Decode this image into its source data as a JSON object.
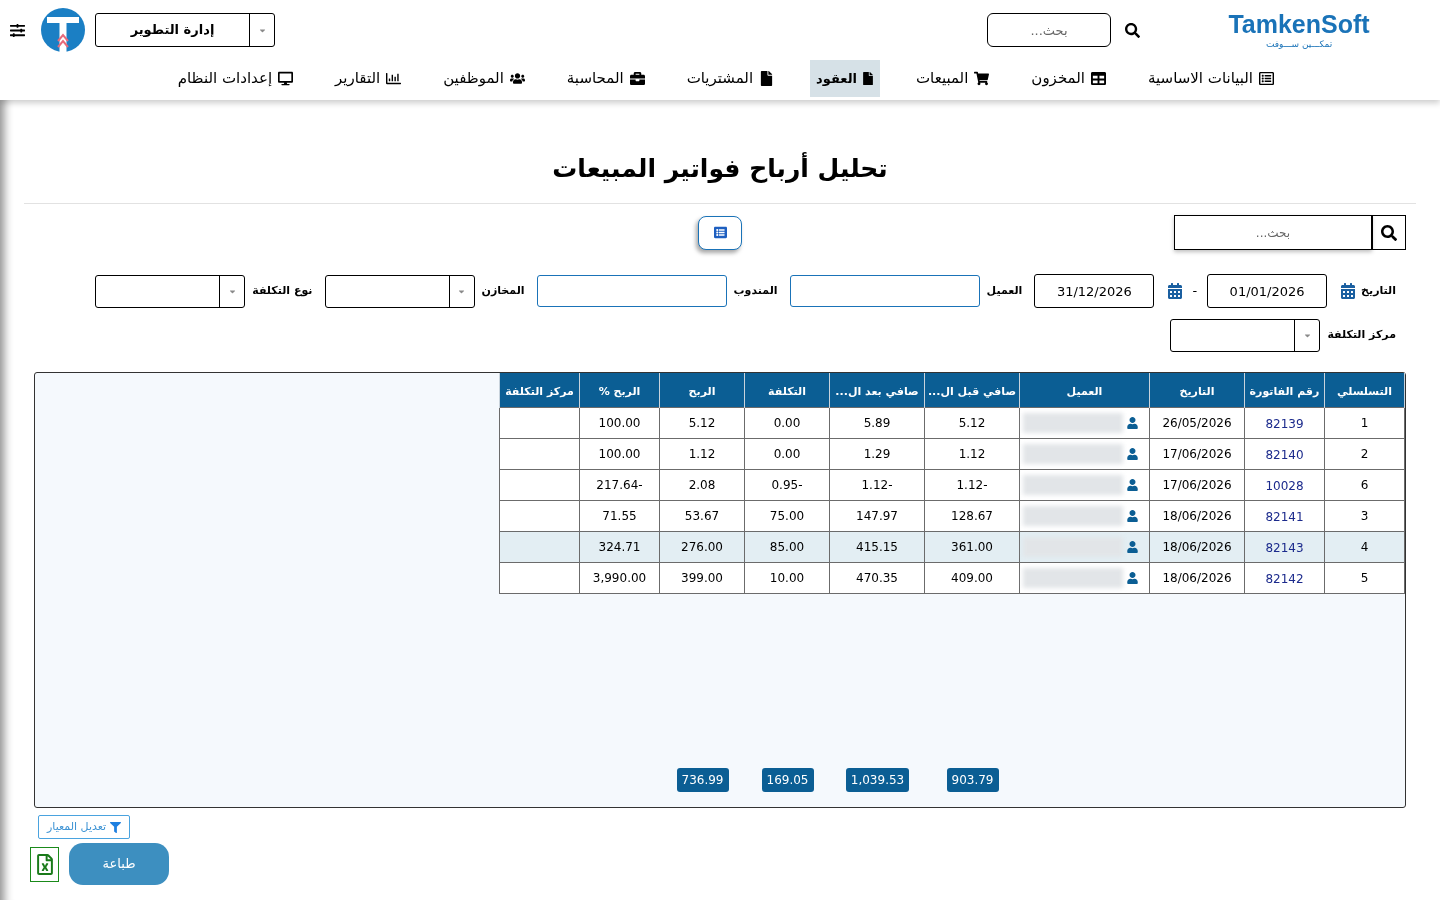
{
  "header": {
    "brand": {
      "name": "TamkenSoft",
      "tagline": "تمكـــين ســـوفت"
    },
    "search": {
      "placeholder": "بحث..."
    },
    "department": {
      "value": "إدارة التطوير"
    }
  },
  "nav": [
    {
      "label": "البيانات الاساسية",
      "selected": false
    },
    {
      "label": "المخزون",
      "selected": false
    },
    {
      "label": "المبيعات",
      "selected": false
    },
    {
      "label": "العقود",
      "selected": true
    },
    {
      "label": "المشتريات",
      "selected": false
    },
    {
      "label": "المحاسبة",
      "selected": false
    },
    {
      "label": "الموظفين",
      "selected": false
    },
    {
      "label": "التقارير",
      "selected": false
    },
    {
      "label": "إعدادات النظام",
      "selected": false
    }
  ],
  "page": {
    "title": "تحليل أرباح فواتير المبيعات",
    "search": {
      "placeholder": "بحث..."
    }
  },
  "filters": [
    {
      "kind": "date_range",
      "label": "التاريخ",
      "from": "01/01/2026",
      "separator": "-",
      "to": "31/12/2026"
    },
    {
      "kind": "text",
      "label": "العميل"
    },
    {
      "kind": "text",
      "label": "المندوب"
    },
    {
      "kind": "select",
      "label": "المخازن"
    },
    {
      "kind": "select",
      "label": "نوع التكلفة"
    },
    {
      "kind": "select",
      "label": "مركز التكلفة"
    }
  ],
  "table": {
    "columns": [
      {
        "kind": "text",
        "label": "التسلسلي"
      },
      {
        "kind": "link",
        "label": "رقم الفاتورة"
      },
      {
        "kind": "text",
        "label": "التاريخ"
      },
      {
        "kind": "customer",
        "label": "العميل"
      },
      {
        "kind": "text",
        "label": "صافي قبل ال..."
      },
      {
        "kind": "text",
        "label": "صافي بعد ال..."
      },
      {
        "kind": "text",
        "label": "التكلفة"
      },
      {
        "kind": "text",
        "label": "الربح"
      },
      {
        "kind": "text",
        "label": "الربح %"
      },
      {
        "kind": "text",
        "label": "مركز التكلفة"
      }
    ],
    "rows": [
      {
        "seq": "1",
        "invoice": "82139",
        "date": "26/05/2026",
        "net_before": "5.12",
        "net_after": "5.89",
        "cost": "0.00",
        "profit": "5.12",
        "profit_pct": "100.00",
        "selected": false
      },
      {
        "seq": "2",
        "invoice": "82140",
        "date": "17/06/2026",
        "net_before": "1.12",
        "net_after": "1.29",
        "cost": "0.00",
        "profit": "1.12",
        "profit_pct": "100.00",
        "selected": false
      },
      {
        "seq": "6",
        "invoice": "10028",
        "date": "17/06/2026",
        "net_before": "1.12-",
        "net_after": "1.12-",
        "cost": "0.95-",
        "profit": "2.08",
        "profit_pct": "217.64-",
        "selected": false
      },
      {
        "seq": "3",
        "invoice": "82141",
        "date": "18/06/2026",
        "net_before": "128.67",
        "net_after": "147.97",
        "cost": "75.00",
        "profit": "53.67",
        "profit_pct": "71.55",
        "selected": false
      },
      {
        "seq": "4",
        "invoice": "82143",
        "date": "18/06/2026",
        "net_before": "361.00",
        "net_after": "415.15",
        "cost": "85.00",
        "profit": "276.00",
        "profit_pct": "324.71",
        "selected": true
      },
      {
        "seq": "5",
        "invoice": "82142",
        "date": "18/06/2026",
        "net_before": "409.00",
        "net_after": "470.35",
        "cost": "10.00",
        "profit": "399.00",
        "profit_pct": "3,990.00",
        "selected": false
      }
    ],
    "totals": {
      "net_before": "903.79",
      "net_after": "1,039.53",
      "cost": "169.05",
      "profit": "736.99"
    }
  },
  "footer": {
    "filter_button": "تعديل المعيار",
    "print_button": "طباعة"
  }
}
